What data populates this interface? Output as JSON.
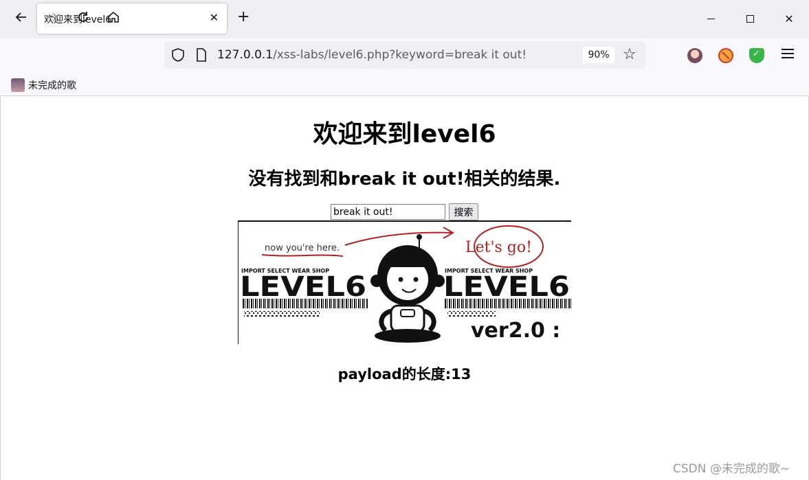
{
  "browser": {
    "tab_title": "欢迎来到level6",
    "url_host": "127.0.0.1",
    "url_path": "/xss-labs/level6.php?keyword=break it out!",
    "zoom": "90%",
    "bookmark_label": "未完成的歌"
  },
  "page": {
    "heading": "欢迎来到level6",
    "result_message": "没有找到和break it out!相关的结果.",
    "search": {
      "value": "break it out!",
      "button_label": "搜索"
    },
    "banner": {
      "note": "now you're here.",
      "callout": "Let's go!",
      "shop_label": "IMPORT SELECT WEAR SHOP",
      "logo_text": "LEVEL6",
      "version": "ver2.0 :"
    },
    "payload_length": "payload的长度:13"
  },
  "watermark": "CSDN @未完成的歌~",
  "colors": {
    "chrome_bg": "#f0f0f4",
    "toolbar_bg": "#f9f9fb",
    "scribble_red": "#b3201f"
  }
}
